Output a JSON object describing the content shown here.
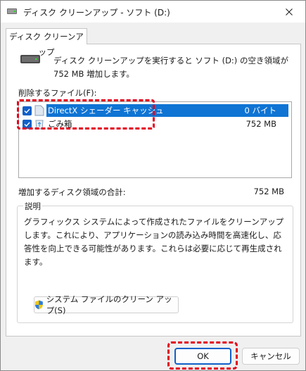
{
  "window": {
    "title": "ディスク クリーンアップ - ソフト (D:)"
  },
  "tab": {
    "label": "ディスク クリーンアップ"
  },
  "summary": {
    "text": "ディスク クリーンアップを実行すると ソフト (D:) の空き領域が 752 MB 増加します。"
  },
  "files": {
    "label": "削除するファイル(F):",
    "items": [
      {
        "name": "DirectX シェーダー キャッシュ",
        "size": "0 バイト",
        "checked": true,
        "selected": true,
        "icon": "file-icon"
      },
      {
        "name": "ごみ箱",
        "size": "752 MB",
        "checked": true,
        "selected": false,
        "icon": "recycle-bin-icon"
      }
    ]
  },
  "gain": {
    "label": "増加するディスク領域の合計:",
    "value": "752 MB"
  },
  "description": {
    "legend": "説明",
    "text": "グラフィックス システムによって作成されたファイルをクリーンアップします。これにより、アプリケーションの読み込み時間を高速化し、応答性を向上できる可能性があります。これらは必要に応じて再生成されます。"
  },
  "buttons": {
    "cleanup_system": "システム ファイルのクリーン アップ(S)",
    "ok": "OK",
    "cancel": "キャンセル"
  },
  "colors": {
    "selection": "#0f74d4",
    "checkbox": "#1160c8",
    "highlight_dash": "#e2001a"
  }
}
